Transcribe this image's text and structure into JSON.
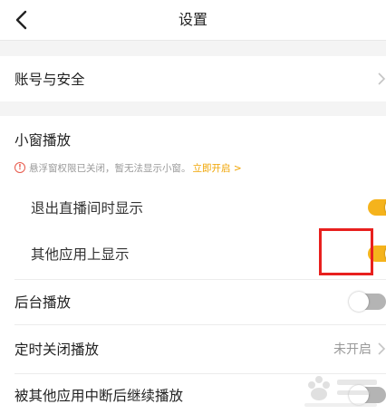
{
  "header": {
    "title": "设置"
  },
  "sections": {
    "account": {
      "label": "账号与安全"
    },
    "mini_window": {
      "title": "小窗播放",
      "notice_text": "悬浮窗权限已关闭，暂无法显示小窗。",
      "notice_link": "立即开启 >",
      "items": [
        {
          "label": "退出直播间时显示",
          "enabled": true
        },
        {
          "label": "其他应用上显示",
          "enabled": true
        }
      ]
    },
    "background_play": {
      "label": "后台播放",
      "enabled": false
    },
    "timer_close": {
      "label": "定时关闭播放",
      "value": "未开启"
    },
    "resume_after_interrupt": {
      "label": "被其他应用中断后继续播放",
      "enabled": false
    }
  },
  "colors": {
    "accent": "#f5b31c",
    "highlight": "#e8201e",
    "off": "#b4b4b4"
  }
}
